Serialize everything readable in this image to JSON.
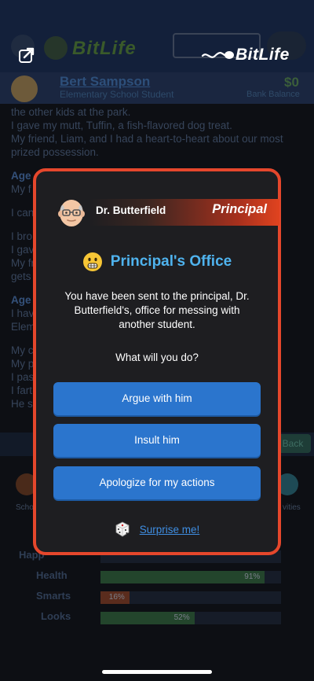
{
  "background": {
    "brand_text": "BitLife",
    "profile": {
      "name": "Bert Sampson",
      "subtitle": "Elementary School Student",
      "money": "$0",
      "money_label": "Bank Balance"
    },
    "log": [
      {
        "type": "text",
        "text": "the other kids at the park."
      },
      {
        "type": "text",
        "text": "I gave my mutt, Tuffin, a fish-flavored dog treat."
      },
      {
        "type": "text",
        "text": "My friend, Liam, and I had a heart-to-heart about our most prized possession."
      },
      {
        "type": "gap"
      },
      {
        "type": "age",
        "text": "Age"
      },
      {
        "type": "text",
        "text": "My f"
      },
      {
        "type": "gap"
      },
      {
        "type": "text",
        "text": "I can"
      },
      {
        "type": "gap"
      },
      {
        "type": "text",
        "text": "I bro"
      },
      {
        "type": "text",
        "text": "I gav"
      },
      {
        "type": "text",
        "text": "My fr"
      },
      {
        "type": "text",
        "text": "gets"
      },
      {
        "type": "gap"
      },
      {
        "type": "age",
        "text": "Age"
      },
      {
        "type": "text",
        "text": "I hav"
      },
      {
        "type": "text",
        "text": "Elem"
      },
      {
        "type": "gap"
      },
      {
        "type": "text",
        "text": "My c"
      },
      {
        "type": "text",
        "text": "My p"
      },
      {
        "type": "text",
        "text": "I pas"
      },
      {
        "type": "text",
        "text": "I fart"
      },
      {
        "type": "text",
        "text": "He s"
      }
    ],
    "back_label": "Back",
    "tabs": {
      "left": "Scho",
      "right": "vities"
    },
    "stats": [
      {
        "label": "Happ",
        "value": 0.0,
        "pct": "",
        "color": "#23303f"
      },
      {
        "label": "Health",
        "value": 0.91,
        "pct": "91%",
        "color": "#23452c"
      },
      {
        "label": "Smarts",
        "value": 0.16,
        "pct": "16%",
        "color": "#5a2c1d"
      },
      {
        "label": "Looks",
        "value": 0.52,
        "pct": "52%",
        "color": "#23452c"
      }
    ]
  },
  "modal": {
    "person_name": "Dr. Butterfield",
    "person_role": "Principal",
    "title": "Principal's Office",
    "message": "You have been sent to the principal, Dr. Butterfield's, office for messing with another student.",
    "question": "What will you do?",
    "choices": [
      "Argue with him",
      "Insult him",
      "Apologize for my actions"
    ],
    "surprise_label": "Surprise me!",
    "colors": {
      "border": "#e5472c",
      "title": "#4fb3ee",
      "button": "#2b75cd",
      "link": "#3f8ee2"
    }
  }
}
